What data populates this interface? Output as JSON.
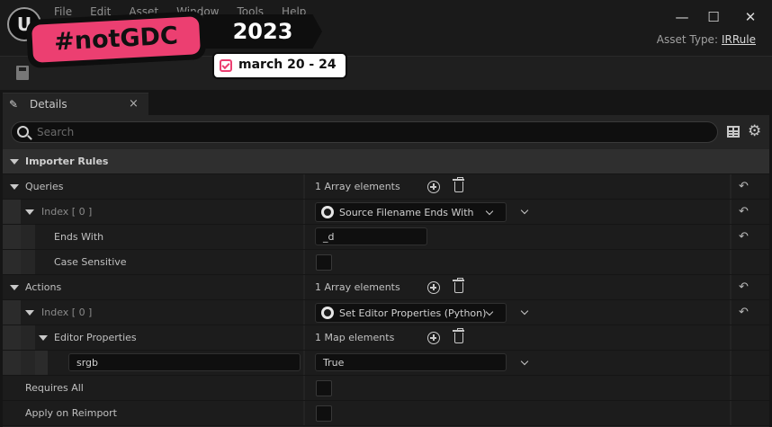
{
  "title_bar": {
    "menu": [
      "File",
      "Edit",
      "Asset",
      "Window",
      "Tools",
      "Help"
    ],
    "asset_type_label": "Asset Type:",
    "asset_type_value": "IRRule",
    "minimize": "—",
    "maximize": "☐",
    "close": "✕"
  },
  "banner": {
    "title": "#notGDC",
    "year": "2023",
    "dates": "march 20 - 24",
    "accent": "#ec3f71"
  },
  "tab": {
    "label": "Details",
    "close": "×"
  },
  "search": {
    "placeholder": "Search"
  },
  "details": {
    "category": "Importer Rules",
    "queries": {
      "label": "Queries",
      "count": "1 Array elements",
      "index_label": "Index [ 0 ]",
      "index_value": "Source Filename Ends With",
      "ends_with_label": "Ends With",
      "ends_with_value": "_d",
      "case_sensitive_label": "Case Sensitive"
    },
    "actions": {
      "label": "Actions",
      "count": "1 Array elements",
      "index_label": "Index [ 0 ]",
      "index_value": "Set Editor Properties (Python)",
      "editor_properties_label": "Editor Properties",
      "editor_properties_count": "1 Map elements",
      "map_key": "srgb",
      "map_value": "True"
    },
    "requires_all_label": "Requires All",
    "apply_on_reimport_label": "Apply on Reimport"
  }
}
